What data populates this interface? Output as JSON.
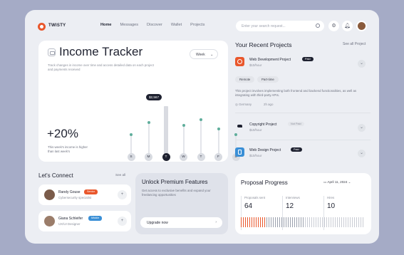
{
  "brand": {
    "name": "TWISTY",
    "color": "#e9572c"
  },
  "nav": {
    "items": [
      "Home",
      "Messages",
      "Discover",
      "Wallet",
      "Projects"
    ],
    "active": "Home"
  },
  "search": {
    "placeholder": "Enter your search request..."
  },
  "toolbar_icons": [
    "search-icon",
    "gear-icon",
    "bell-icon",
    "user-avatar"
  ],
  "income": {
    "title": "Income Tracker",
    "description": "Track changes in income over time and access detailed data on each project and payments received",
    "range": "Week",
    "change": "+20%",
    "change_desc": "This week's income is higher than last week's",
    "highlight_value": "$2,567",
    "days": [
      {
        "label": "S",
        "level": 0.38
      },
      {
        "label": "M",
        "level": 0.58
      },
      {
        "label": "T",
        "level": 0.86
      },
      {
        "label": "W",
        "level": 0.54
      },
      {
        "label": "T",
        "level": 0.64
      },
      {
        "label": "F",
        "level": 0.48
      },
      {
        "label": "S",
        "level": 0.38
      }
    ],
    "active_day": 2,
    "accent": "#5fae9b"
  },
  "projects": {
    "title": "Your Recent Projects",
    "see_all": "See all Project",
    "items": [
      {
        "name": "Web Development Project",
        "price": "$10/hour",
        "tag": "Paid",
        "icon": "target-icon",
        "icon_color": "#e9572c",
        "chips": [
          "Remote",
          "Part-time"
        ],
        "description": "This project involves implementing both frontend and backend functionalities, as well as integrating with third-party APIs.",
        "location": "Germany",
        "time": "2h ago"
      },
      {
        "name": "Copyright Project",
        "price": "$10/hour",
        "tag": "Not Paid",
        "icon": "bird-icon",
        "icon_color": "#1e2130"
      },
      {
        "name": "Web Design Project",
        "price": "$10/hour",
        "tag": "Paid",
        "icon": "design-icon",
        "icon_color": "#3a8fd6"
      }
    ]
  },
  "connect": {
    "title": "Let's Connect",
    "see_all": "See all",
    "people": [
      {
        "name": "Randy Gouse",
        "role": "Cybersecurity specialist",
        "badge": "Senior",
        "badge_color": "#e9572c"
      },
      {
        "name": "Giana Schleifer",
        "role": "UX/UI Designer",
        "badge": "Middle",
        "badge_color": "#3a8fd6"
      }
    ]
  },
  "premium": {
    "title": "Unlock Premium Features",
    "description": "Get access to exclusive benefits and expand your freelancing opportunities",
    "button": "Upgrade now"
  },
  "proposal": {
    "title": "Proposal Progress",
    "date": "April 11, 2024",
    "stats": [
      {
        "label": "Proposals sent",
        "value": "64"
      },
      {
        "label": "Interviews",
        "value": "12"
      },
      {
        "label": "Hires",
        "value": "10"
      }
    ]
  }
}
